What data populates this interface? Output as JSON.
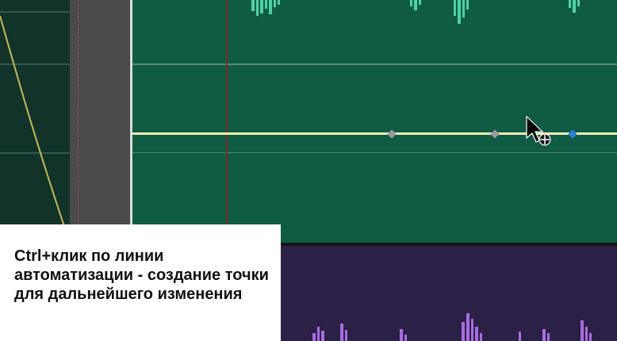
{
  "caption": {
    "text": "Ctrl+клик по линии автоматизации - создание точки для дальнейшего изменения"
  },
  "colors": {
    "green_track": "#0f5b44",
    "green_wave": "#4fd1a7",
    "purple_track": "#2b2045",
    "purple_wave": "#a86de0",
    "automation_line": "#f0f0b0",
    "keyframe_point": "#9a9a9a",
    "active_point": "#2f7fe0"
  },
  "icons": [
    "cursor-arrow-icon",
    "move-crosshair-icon"
  ]
}
